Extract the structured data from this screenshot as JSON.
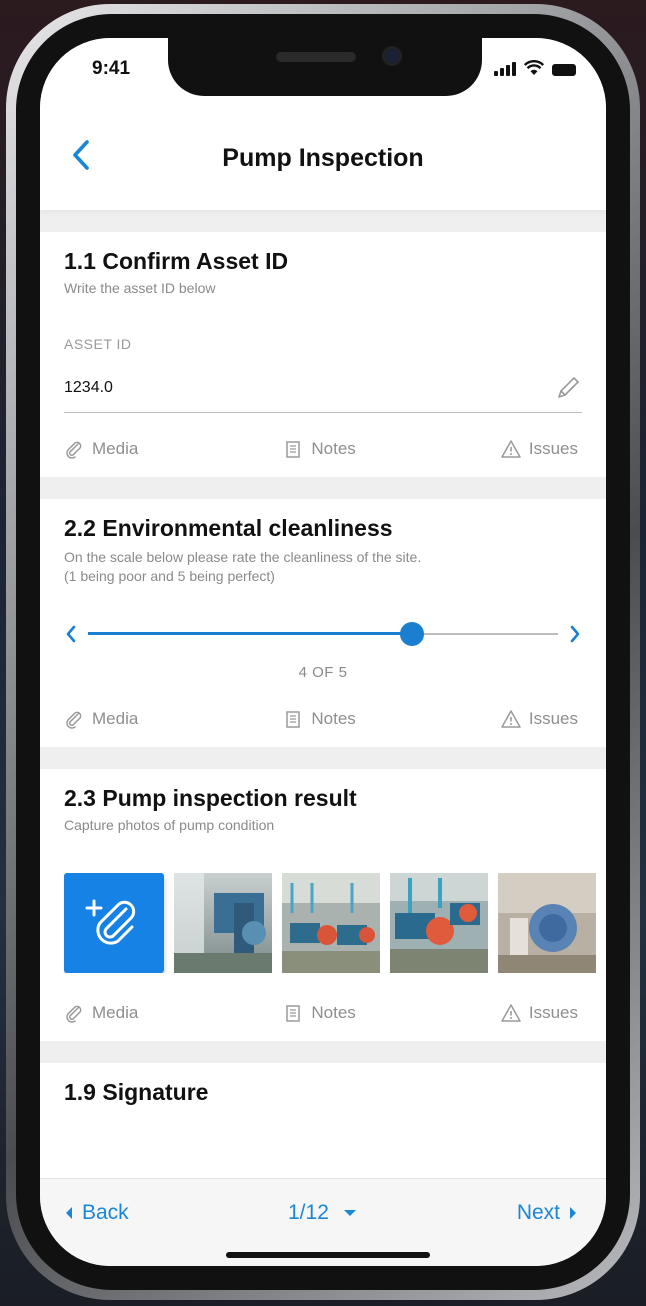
{
  "status": {
    "time": "9:41"
  },
  "header": {
    "title": "Pump Inspection",
    "back_icon": "chevron-left-icon"
  },
  "colors": {
    "accent": "#1a7ed1",
    "attach_button": "#1682e6",
    "muted": "#8f8f8f"
  },
  "actions": {
    "media": "Media",
    "notes": "Notes",
    "issues": "Issues"
  },
  "sections": {
    "asset": {
      "title": "1.1 Confirm Asset ID",
      "subtitle": "Write the asset ID below",
      "field_label": "ASSET ID",
      "field_value": "1234.0"
    },
    "cleanliness": {
      "title": "2.2 Environmental cleanliness",
      "subtitle_line1": "On the scale below please rate the cleanliness of the site.",
      "subtitle_line2": "(1 being poor and 5 being perfect)",
      "value": 4,
      "max": 5,
      "value_label": "4 OF 5"
    },
    "pump": {
      "title": "2.3 Pump inspection result",
      "subtitle": "Capture photos of pump condition",
      "photo_count": 4
    },
    "signature": {
      "title": "1.9 Signature"
    }
  },
  "footer": {
    "back": "Back",
    "page": "1/12",
    "next": "Next"
  }
}
